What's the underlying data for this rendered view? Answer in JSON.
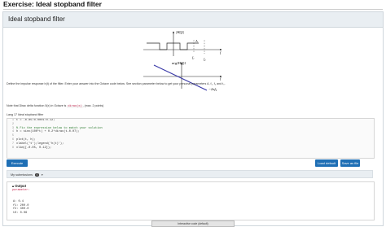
{
  "page": {
    "title": "Exercise: Ideal stopband filter"
  },
  "card": {
    "header": "Ideal stopband filter"
  },
  "diagram": {
    "mag_label": "|H(f)|",
    "mag_marker": "A",
    "f_axis": "f",
    "f1_label": "f₁",
    "f2_label": "f₂",
    "phase_label": "arg{H(f)}",
    "phase_axis": "f",
    "phase_slope_label": "−2πf₀"
  },
  "text": {
    "desc1": "Define the impulse response h(t) of the filter. Enter your answer into the Octave code below. See section  parameter  below to get your personal parameters A, f₁, f₂ and t₀.",
    "desc2_pre": "Note that Dirac delta function δ(x) in Octave is ",
    "desc2_code": "dirac(x)",
    "desc2_post": ", (max. 2 points)"
  },
  "editor": {
    "label": "Lang 17   Ideal stopband filter",
    "lines": [
      "t = -0.05:0.0001:0.12;",
      "",
      "% Fix the expression below to match your solution",
      "h = sinc(100*t) + 0.2*dirac(t-0.07);",
      "",
      "plot(t, h);",
      "xlabel('t');legend('h(t)');",
      "xlim([-0.05, 0.12]);"
    ]
  },
  "buttons": {
    "execute": "Execute",
    "load_default": "Load default",
    "save_as_file": "Save as file"
  },
  "submissions": {
    "label": "My submissions",
    "count": "0"
  },
  "output": {
    "title": "Output",
    "subtitle": "parameter:",
    "lines": [
      "A: 0.4",
      "f1: 200.0",
      "f2: 300.0",
      "t0: 0.06"
    ]
  },
  "interactive": {
    "label": "Interactive code (default)"
  },
  "colors": {
    "accent": "#1f6fb5",
    "phase_line": "#3a3aa8"
  }
}
